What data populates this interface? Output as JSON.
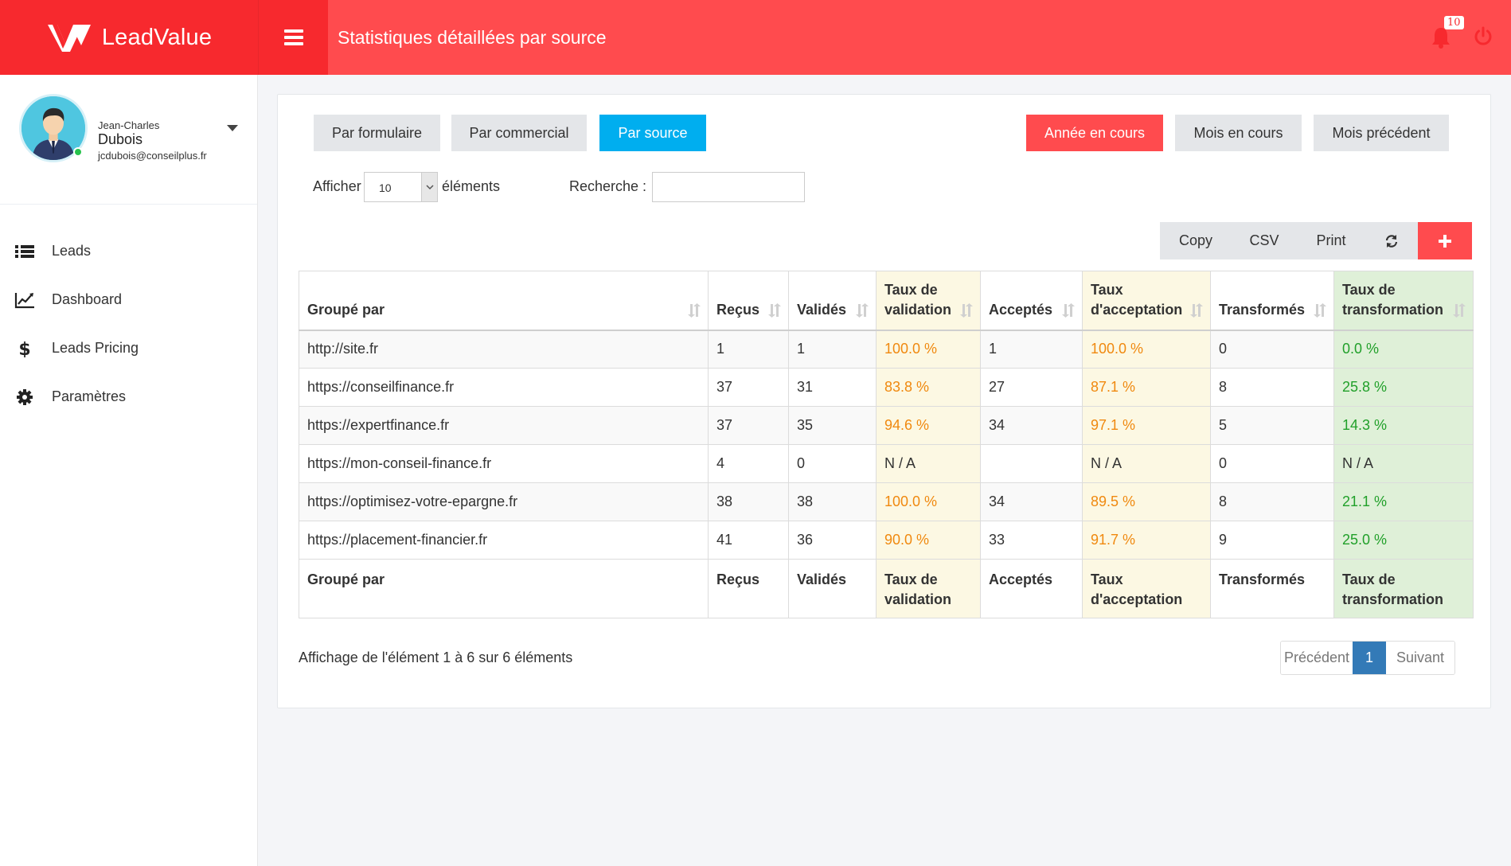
{
  "brand": {
    "name": "LeadValue"
  },
  "header": {
    "title": "Statistiques détaillées par source",
    "notification_count": "10"
  },
  "profile": {
    "first_name": "Jean-Charles",
    "last_name": "Dubois",
    "email": "jcdubois@conseilplus.fr"
  },
  "nav": [
    {
      "label": "Leads",
      "icon": "list-icon"
    },
    {
      "label": "Dashboard",
      "icon": "line-chart-icon"
    },
    {
      "label": "Leads Pricing",
      "icon": "dollar-icon"
    },
    {
      "label": "Paramètres",
      "icon": "gear-icon"
    }
  ],
  "filters": {
    "group_by": [
      "Par formulaire",
      "Par commercial",
      "Par source"
    ],
    "active_group": "Par source",
    "periods": [
      "Année en cours",
      "Mois en cours",
      "Mois précédent"
    ],
    "active_period": "Année en cours"
  },
  "controls": {
    "show_label": "Afficher",
    "page_size": "10",
    "elements_label": "éléments",
    "search_label": "Recherche :",
    "search_value": ""
  },
  "toolbar": {
    "copy": "Copy",
    "csv": "CSV",
    "print": "Print"
  },
  "table": {
    "columns": [
      "Groupé par",
      "Reçus",
      "Validés",
      "Taux de validation",
      "Acceptés",
      "Taux d'acceptation",
      "Transformés",
      "Taux de transformation"
    ],
    "rows": [
      [
        "http://site.fr",
        "1",
        "1",
        "100.0 %",
        "1",
        "100.0 %",
        "0",
        "0.0 %"
      ],
      [
        "https://conseilfinance.fr",
        "37",
        "31",
        "83.8 %",
        "27",
        "87.1 %",
        "8",
        "25.8 %"
      ],
      [
        "https://expertfinance.fr",
        "37",
        "35",
        "94.6 %",
        "34",
        "97.1 %",
        "5",
        "14.3 %"
      ],
      [
        "https://mon-conseil-finance.fr",
        "4",
        "0",
        "N / A",
        "",
        "N / A",
        "0",
        "N / A"
      ],
      [
        "https://optimisez-votre-epargne.fr",
        "38",
        "38",
        "100.0 %",
        "34",
        "89.5 %",
        "8",
        "21.1 %"
      ],
      [
        "https://placement-financier.fr",
        "41",
        "36",
        "90.0 %",
        "33",
        "91.7 %",
        "9",
        "25.0 %"
      ]
    ]
  },
  "footer": {
    "info": "Affichage de l'élément 1 à 6 sur 6 éléments",
    "prev": "Précédent",
    "page": "1",
    "next": "Suivant"
  }
}
